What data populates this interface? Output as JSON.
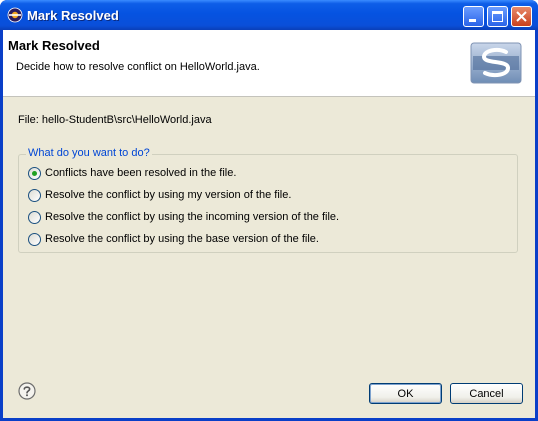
{
  "window": {
    "title": "Mark Resolved"
  },
  "banner": {
    "title": "Mark Resolved",
    "description": "Decide how to resolve conflict on HelloWorld.java."
  },
  "file": {
    "label": "File: hello-StudentB\\src\\HelloWorld.java"
  },
  "group": {
    "title": "What do you want to do?",
    "options": [
      {
        "label": "Conflicts have been resolved in the file.",
        "checked": true
      },
      {
        "label": "Resolve the conflict by using my version of the file.",
        "checked": false
      },
      {
        "label": "Resolve the conflict by using the incoming version of the file.",
        "checked": false
      },
      {
        "label": "Resolve the conflict by using the base version of the file.",
        "checked": false
      }
    ]
  },
  "buttons": {
    "ok": "OK",
    "cancel": "Cancel"
  },
  "icons": {
    "title": "eclipse-icon",
    "banner": "subversion-logo-icon",
    "help": "help-icon"
  },
  "colors": {
    "titlebar": "#0553e1",
    "dialog_bg": "#ece9d8",
    "group_title": "#0046d5",
    "radio_checked": "#21a121"
  }
}
